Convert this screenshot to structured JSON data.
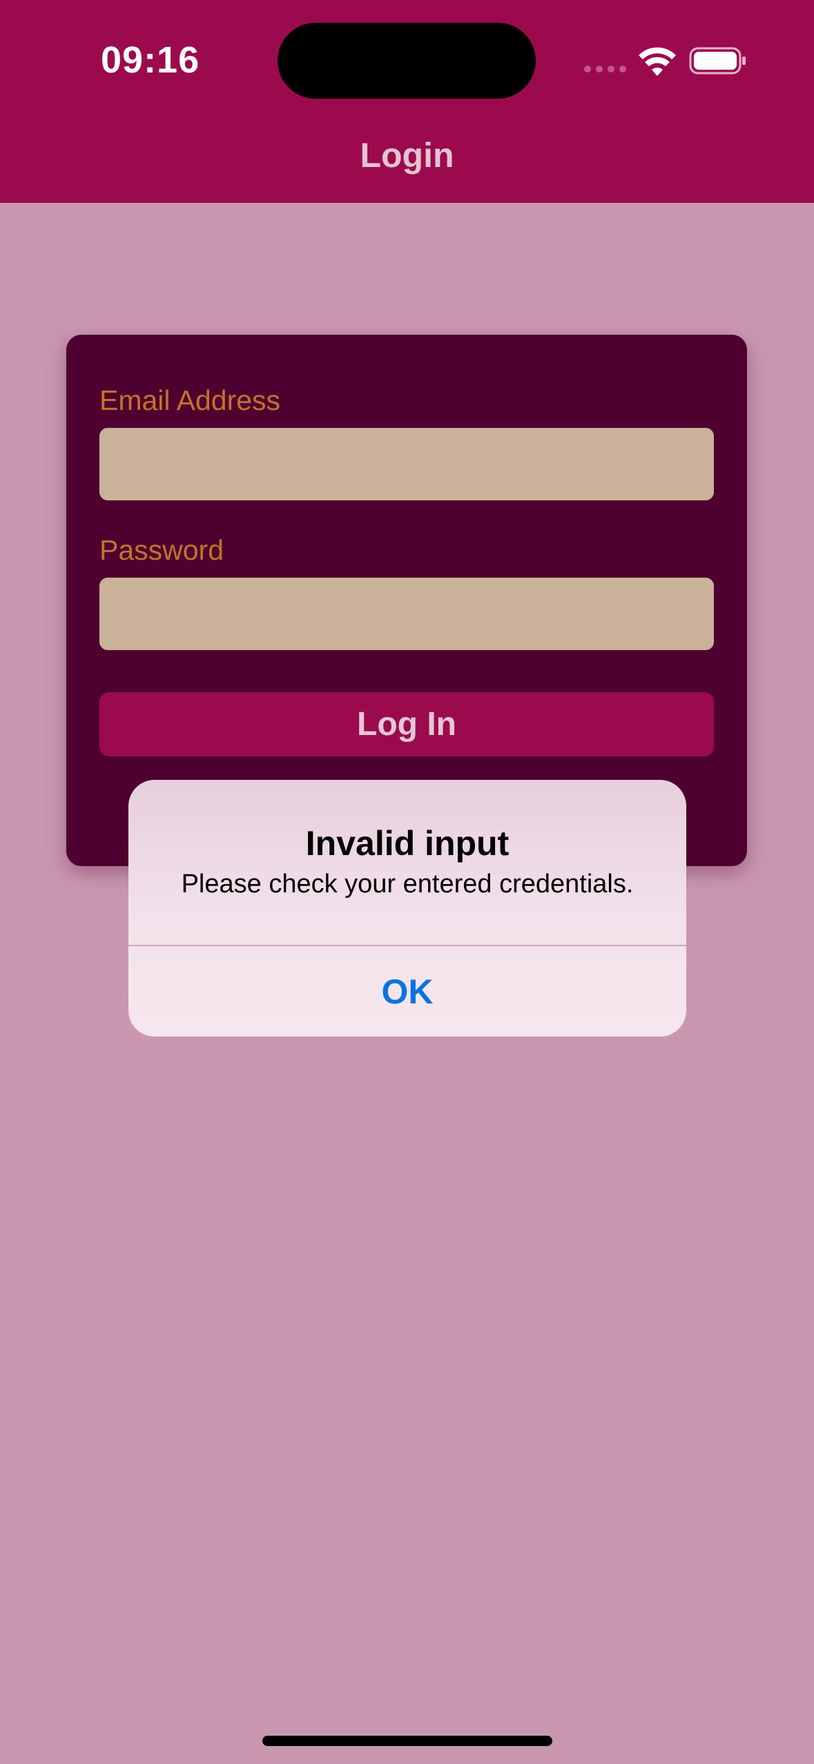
{
  "status_bar": {
    "time": "09:16",
    "icons": [
      "signal-icon",
      "wifi-icon",
      "battery-icon"
    ]
  },
  "header": {
    "title": "Login"
  },
  "form": {
    "email_label": "Email Address",
    "email_value": "",
    "password_label": "Password",
    "password_value": "",
    "login_button": "Log In"
  },
  "alert": {
    "title": "Invalid input",
    "message": "Please check your entered credentials.",
    "ok_button": "OK"
  },
  "colors": {
    "header_bg": "#9c0a4e",
    "page_bg": "#c998b0",
    "card_bg": "#4e0030",
    "label": "#c2732a",
    "field_bg": "#cab199",
    "alert_button": "#0a72e0"
  }
}
